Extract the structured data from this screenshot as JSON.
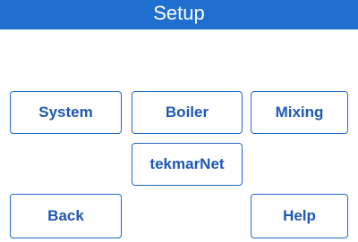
{
  "header": {
    "title": "Setup"
  },
  "menu": {
    "system_label": "System",
    "boiler_label": "Boiler",
    "mixing_label": "Mixing",
    "tekmarnet_label": "tekmarNet"
  },
  "footer": {
    "back_label": "Back",
    "help_label": "Help"
  },
  "colors": {
    "title_bar": "#1e6fd0",
    "button_border": "#2468c8",
    "button_text": "#1e58b4",
    "background": "#ffffff"
  }
}
